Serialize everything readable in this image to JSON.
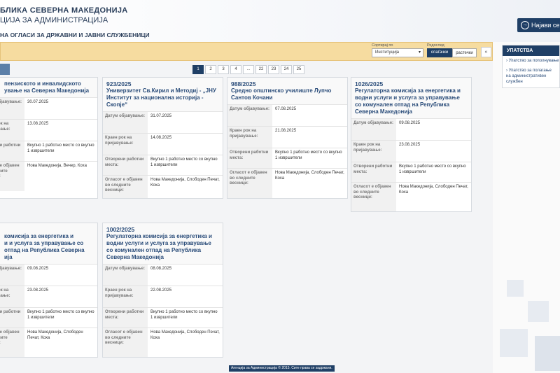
{
  "header": {
    "title_line1": "БЛИКА СЕВЕРНА МАКЕДОНИЈА",
    "title_line2": "ЦИЈА ЗА АДМИНИСТРАЦИЈА",
    "subtitle": "НА ОГЛАСИ ЗА ДРЖАВНИ И ЈАВНИ СЛУЖБЕНИЦИ",
    "login_label": "Најави се"
  },
  "filters": {
    "sort_label": "Сортирај по",
    "sort_value": "Институција",
    "order_label": "Редослед",
    "order_desc": "опаѓачки",
    "order_asc": "растечки"
  },
  "pagination": [
    "1",
    "2",
    "3",
    "4",
    "...",
    "22",
    "23",
    "24",
    "25"
  ],
  "labels": {
    "published": "Датум објавување:",
    "deadline": "Краен рок на пријавување:",
    "positions": "Отворени работни места:",
    "newspapers": "Огласот е објавен во следните весници:"
  },
  "cards": [
    {
      "num": "",
      "title": "пензиското и инвалидското\nување на Северна Македонија",
      "published": "30.07.2025",
      "deadline": "13.08.2025",
      "positions": "Вкупно 1 работно место со вкупно 1 извршители",
      "newspapers": "Нова Македонија, Вечер, Коха"
    },
    {
      "num": "923/2025",
      "title": "Универзитет Св.Кирил и Методиј - „ЈНУ Институт за национална историја - Скопје“",
      "published": "31.07.2025",
      "deadline": "14.08.2025",
      "positions": "Вкупно 1 работно место со вкупно 1 извршители",
      "newspapers": "Нова Македонија, Слободен Печат, Коха"
    },
    {
      "num": "988/2025",
      "title": "Средно општинско училиште Лупчо Сантов Кочани",
      "published": "07.08.2025",
      "deadline": "21.08.2025",
      "positions": "Вкупно 1 работно место со вкупно 1 извршители",
      "newspapers": "Нова Македонија, Слободен Печат, Коха"
    },
    {
      "num": "1026/2025",
      "title": "Регулаторна комисија за енергетика и водни услуги и услуга за управување со комунален отпад на Република Северна Македонија",
      "published": "09.08.2025",
      "deadline": "23.08.2025",
      "positions": "Вкупно 1 работно место со вкупно 1 извршители",
      "newspapers": "Нова Македонија, Слободен Печат, Коха"
    },
    {
      "num": "025",
      "title": "комисија за енергетика и\nи и услуга за управување со\nотпад на Република Северна\nија",
      "published": "09.08.2025",
      "deadline": "23.08.2025",
      "positions": "Вкупно 1 работно место со вкупно 1 извршители",
      "newspapers": "Нова Македонија, Слободен Печат, Коха"
    },
    {
      "num": "1002/2025",
      "title": "Регулаторна комисија за енергетика и водни услуги и услуга за управување со комунален отпад на Република Северна Македонија",
      "published": "08.08.2025",
      "deadline": "22.08.2025",
      "positions": "Вкупно 1 работно место со вкупно 1 извршители",
      "newspapers": "Нова Македонија, Слободен Печат, Коха"
    }
  ],
  "sidebar": {
    "heading": "УПАТСТВА",
    "items": [
      "Упатство за пополнување",
      "Упатство за полагање на административен службен"
    ]
  },
  "footer": "Агенција за Администрација © 2015. Сите права се задржани."
}
